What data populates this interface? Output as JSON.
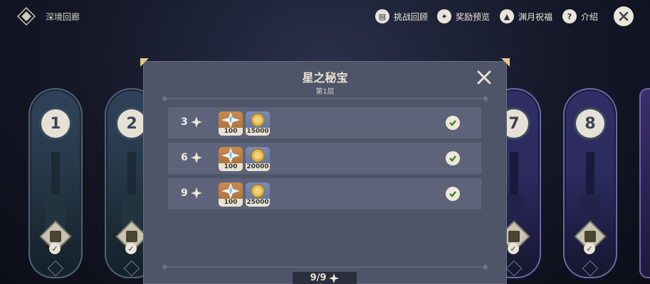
{
  "header": {
    "title": "深境回廊",
    "nav": [
      {
        "label": "挑战回顾",
        "icon": "book-icon"
      },
      {
        "label": "奖励预览",
        "icon": "star-badge-icon"
      },
      {
        "label": "渊月祝福",
        "icon": "moon-blessing-icon"
      },
      {
        "label": "介绍",
        "icon": "help-icon"
      }
    ]
  },
  "floors": [
    {
      "number": "1"
    },
    {
      "number": "2"
    },
    {
      "number": "7"
    },
    {
      "number": "8"
    }
  ],
  "dialog": {
    "title": "星之秘宝",
    "subtitle": "第1层",
    "rows": [
      {
        "stars": "3",
        "gem_qty": "100",
        "coin_qty": "15000"
      },
      {
        "stars": "6",
        "gem_qty": "100",
        "coin_qty": "20000"
      },
      {
        "stars": "9",
        "gem_qty": "100",
        "coin_qty": "25000"
      }
    ],
    "total": "9/9"
  },
  "colors": {
    "accent": "#ebe4cf",
    "panel": "#4f5569",
    "row": "#5d6479",
    "check": "#4a7a30"
  }
}
